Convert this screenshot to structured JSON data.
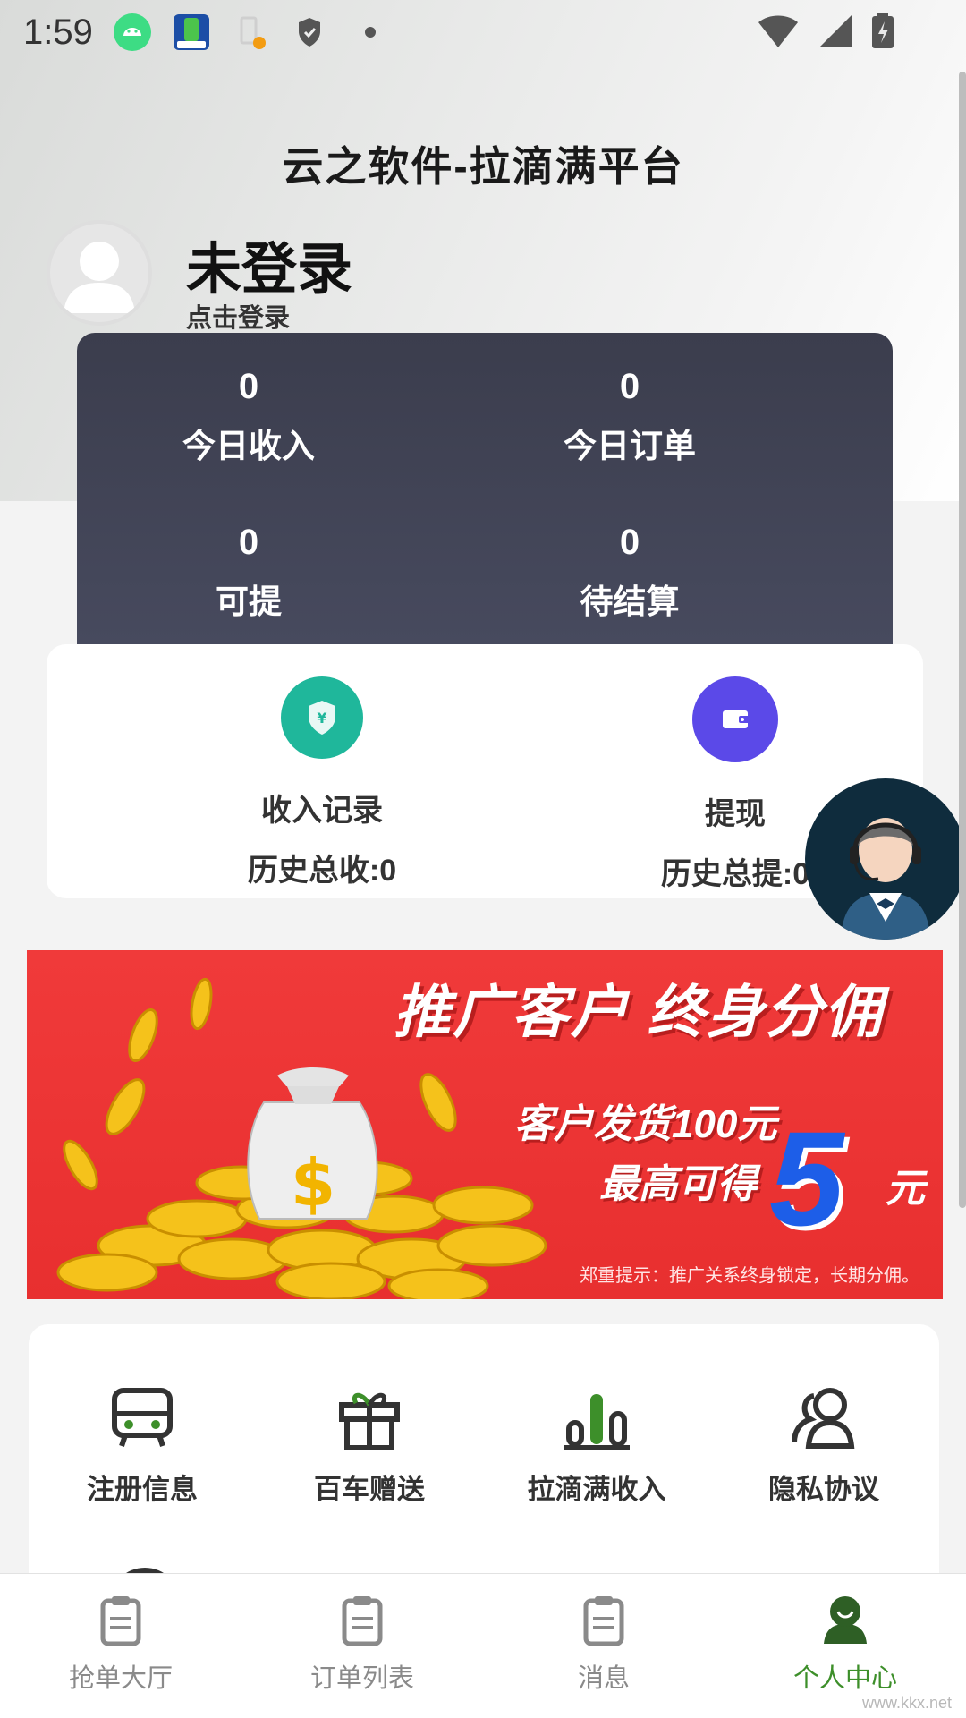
{
  "status_bar": {
    "time": "1:59"
  },
  "header": {
    "title": "云之软件-拉滴满平台"
  },
  "profile": {
    "name": "未登录",
    "action": "点击登录"
  },
  "stats": [
    {
      "value": "0",
      "label": "今日收入"
    },
    {
      "value": "0",
      "label": "今日订单"
    },
    {
      "value": "0",
      "label": "可提"
    },
    {
      "value": "0",
      "label": "待结算"
    }
  ],
  "wallet": {
    "income": {
      "title": "收入记录",
      "sub": "历史总收:0",
      "icon": "shield-yen-icon",
      "color": "#1fb79b"
    },
    "withdraw": {
      "title": "提现",
      "sub": "历史总提:0",
      "icon": "wallet-icon",
      "color": "#5b49e8"
    }
  },
  "banner": {
    "headline": "推广客户  终身分佣",
    "line1": "客户发货100元",
    "line2": "最高可得",
    "amount": "5",
    "unit": "元",
    "note": "郑重提示：推广关系终身锁定，长期分佣。"
  },
  "menu": [
    {
      "label": "注册信息",
      "icon": "car-icon"
    },
    {
      "label": "百车赠送",
      "icon": "gift-icon"
    },
    {
      "label": "拉滴满收入",
      "icon": "bar-chart-icon"
    },
    {
      "label": "隐私协议",
      "icon": "users-icon"
    }
  ],
  "tabs": [
    {
      "label": "抢单大厅",
      "icon": "clipboard-icon",
      "active": false
    },
    {
      "label": "订单列表",
      "icon": "clipboard-icon",
      "active": false
    },
    {
      "label": "消息",
      "icon": "clipboard-icon",
      "active": false
    },
    {
      "label": "个人中心",
      "icon": "person-icon",
      "active": true
    }
  ],
  "colors": {
    "accent": "#3d8f2a",
    "stats_bg": "#3b3d4d",
    "banner": "#e8302f"
  },
  "watermark": "www.kkx.net"
}
